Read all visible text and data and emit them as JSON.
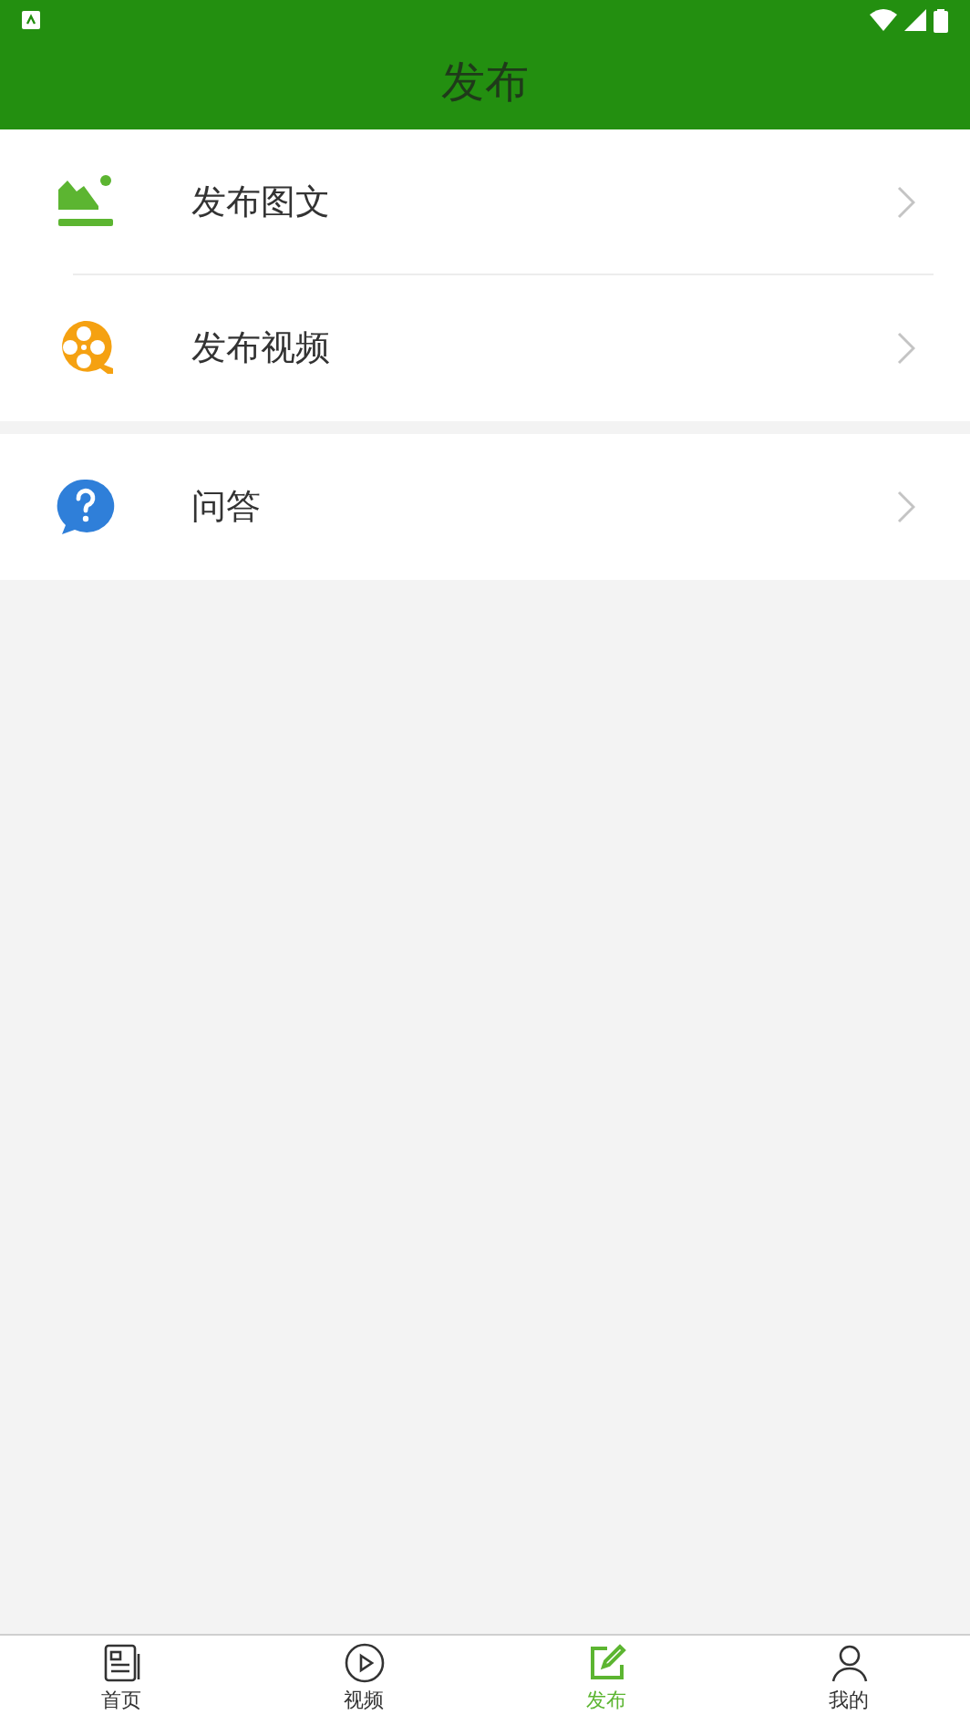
{
  "header": {
    "title": "发布"
  },
  "groups": [
    {
      "items": [
        {
          "kind": "image",
          "label": "发布图文"
        },
        {
          "kind": "video",
          "label": "发布视频"
        }
      ]
    },
    {
      "items": [
        {
          "kind": "question",
          "label": "问答"
        }
      ]
    }
  ],
  "tabs": [
    {
      "kind": "home",
      "label": "首页",
      "selected": false
    },
    {
      "kind": "video",
      "label": "视频",
      "selected": false
    },
    {
      "kind": "publish",
      "label": "发布",
      "selected": true
    },
    {
      "kind": "me",
      "label": "我的",
      "selected": false
    }
  ]
}
